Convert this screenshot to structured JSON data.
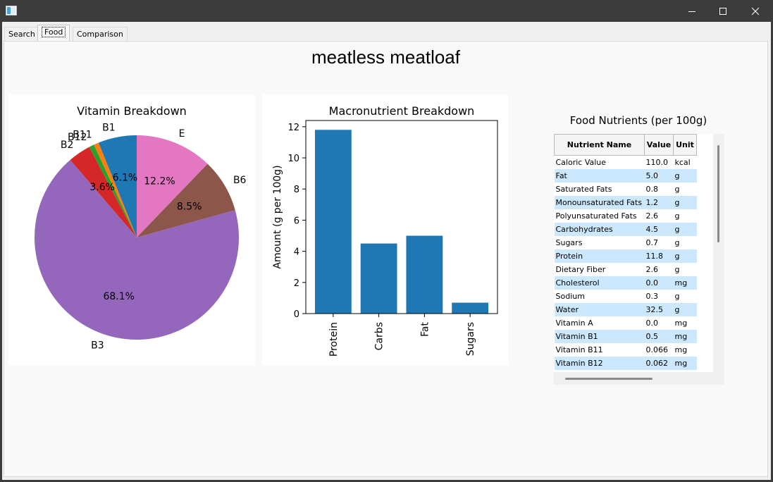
{
  "window": {
    "minimize_glyph": "—",
    "maximize_glyph": "☐",
    "close_glyph": "✕"
  },
  "tabs": [
    {
      "label": "Search",
      "active": false
    },
    {
      "label": "Food",
      "active": true
    },
    {
      "label": "Comparison",
      "active": false
    }
  ],
  "food_title": "meatless meatloaf",
  "pie_chart": {
    "title": "Vitamin Breakdown",
    "chart_data": {
      "type": "pie",
      "title": "Vitamin Breakdown",
      "slices": [
        {
          "label": "B1",
          "percent": 6.1,
          "pct_label": "6.1%",
          "color": "#1f77b4"
        },
        {
          "label": "B11",
          "percent": 0.8,
          "pct_label": "",
          "color": "#ff7f0e"
        },
        {
          "label": "B12",
          "percent": 0.8,
          "pct_label": "",
          "color": "#2ca02c"
        },
        {
          "label": "B2",
          "percent": 3.6,
          "pct_label": "3.6%",
          "color": "#d62728"
        },
        {
          "label": "B3",
          "percent": 68.1,
          "pct_label": "68.1%",
          "color": "#9467bd"
        },
        {
          "label": "B6",
          "percent": 8.5,
          "pct_label": "8.5%",
          "color": "#8c564b"
        },
        {
          "label": "E",
          "percent": 12.2,
          "pct_label": "12.2%",
          "color": "#e377c2"
        }
      ]
    }
  },
  "bar_chart": {
    "title": "Macronutrient Breakdown",
    "chart_data": {
      "type": "bar",
      "title": "Macronutrient Breakdown",
      "ylabel": "Amount (g per 100g)",
      "categories": [
        "Protein",
        "Carbs",
        "Fat",
        "Sugars"
      ],
      "values": [
        11.8,
        4.5,
        5.0,
        0.7
      ],
      "ylim": [
        0,
        12.4
      ],
      "yticks": [
        0,
        2,
        4,
        6,
        8,
        10,
        12
      ],
      "color": "#1f77b4"
    }
  },
  "nutrients": {
    "title": "Food Nutrients (per 100g)",
    "headers": [
      "Nutrient Name",
      "Value",
      "Unit"
    ],
    "rows": [
      [
        "Caloric Value",
        "110.0",
        "kcal"
      ],
      [
        "Fat",
        "5.0",
        "g"
      ],
      [
        "Saturated Fats",
        "0.8",
        "g"
      ],
      [
        "Monounsaturated Fats",
        "1.2",
        "g"
      ],
      [
        "Polyunsaturated Fats",
        "2.6",
        "g"
      ],
      [
        "Carbohydrates",
        "4.5",
        "g"
      ],
      [
        "Sugars",
        "0.7",
        "g"
      ],
      [
        "Protein",
        "11.8",
        "g"
      ],
      [
        "Dietary Fiber",
        "2.6",
        "g"
      ],
      [
        "Cholesterol",
        "0.0",
        "mg"
      ],
      [
        "Sodium",
        "0.3",
        "g"
      ],
      [
        "Water",
        "32.5",
        "g"
      ],
      [
        "Vitamin A",
        "0.0",
        "mg"
      ],
      [
        "Vitamin B1",
        "0.5",
        "mg"
      ],
      [
        "Vitamin B11",
        "0.066",
        "mg"
      ],
      [
        "Vitamin B12",
        "0.062",
        "mg"
      ]
    ]
  }
}
